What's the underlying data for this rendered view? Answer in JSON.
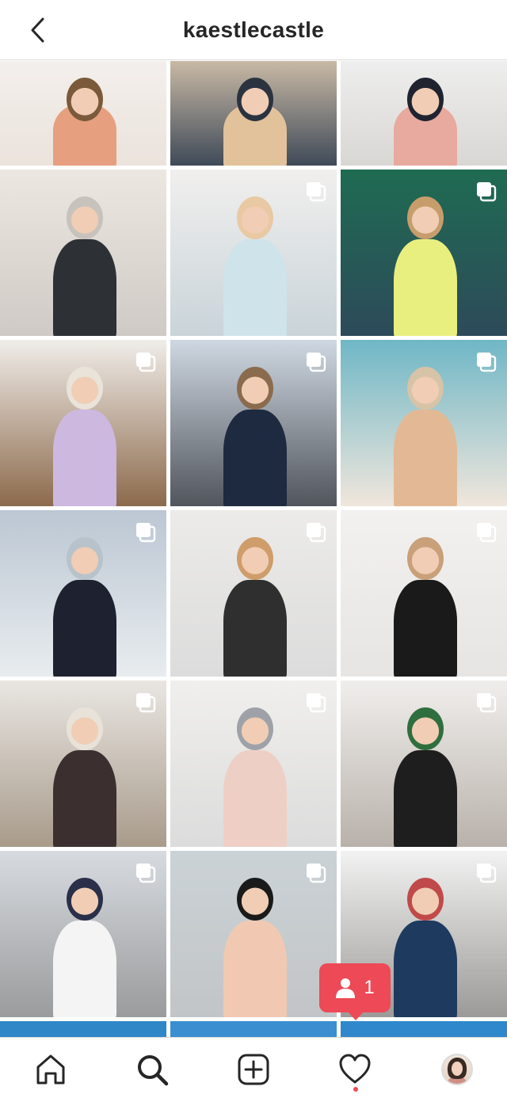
{
  "header": {
    "title": "kaestlecastle",
    "back_icon": "chevron-left-icon"
  },
  "grid": {
    "columns": 3,
    "tiles": [
      {
        "row": 1,
        "col": 1,
        "carousel": false,
        "bg": [
          "#f3efec",
          "#ebe3dc"
        ],
        "subject": "#e6a07f",
        "accent": "#7a5a3a"
      },
      {
        "row": 1,
        "col": 2,
        "carousel": false,
        "bg": [
          "#c9b9a5",
          "#3f4a58"
        ],
        "subject": "#e2c29a",
        "accent": "#2b3340"
      },
      {
        "row": 1,
        "col": 3,
        "carousel": false,
        "bg": [
          "#eeeeee",
          "#d9d7d4"
        ],
        "subject": "#e8a99e",
        "accent": "#1f2430"
      },
      {
        "row": 2,
        "col": 1,
        "carousel": false,
        "bg": [
          "#ece7e1",
          "#cfcac5"
        ],
        "subject": "#2d3035",
        "accent": "#c8c2bd"
      },
      {
        "row": 2,
        "col": 2,
        "carousel": true,
        "bg": [
          "#f1efee",
          "#c9d4d9"
        ],
        "subject": "#cfe3ea",
        "accent": "#e8c9a3"
      },
      {
        "row": 2,
        "col": 3,
        "carousel": true,
        "bg": [
          "#1f6b52",
          "#2d4a5a"
        ],
        "subject": "#e9ef7e",
        "accent": "#c79d6b"
      },
      {
        "row": 3,
        "col": 1,
        "carousel": true,
        "bg": [
          "#f0ede9",
          "#8c6a4c"
        ],
        "subject": "#cdb8e0",
        "accent": "#e9e3da"
      },
      {
        "row": 3,
        "col": 2,
        "carousel": true,
        "bg": [
          "#cfd8e2",
          "#51555c"
        ],
        "subject": "#1e2a3f",
        "accent": "#8a6b4e"
      },
      {
        "row": 3,
        "col": 3,
        "carousel": true,
        "bg": [
          "#6fb7c6",
          "#f0e6dc"
        ],
        "subject": "#e2b994",
        "accent": "#d7c3a8"
      },
      {
        "row": 4,
        "col": 1,
        "carousel": true,
        "bg": [
          "#bcc7d3",
          "#e8ecef"
        ],
        "subject": "#1e2230",
        "accent": "#b8c2cb"
      },
      {
        "row": 4,
        "col": 2,
        "carousel": true,
        "bg": [
          "#ecebe9",
          "#dcdcdc"
        ],
        "subject": "#2f2f2f",
        "accent": "#cf9d6a"
      },
      {
        "row": 4,
        "col": 3,
        "carousel": true,
        "bg": [
          "#f2f1f0",
          "#e7e5e3"
        ],
        "subject": "#1a1a1a",
        "accent": "#c9a07a"
      },
      {
        "row": 5,
        "col": 1,
        "carousel": true,
        "bg": [
          "#e9e6e2",
          "#a89b8b"
        ],
        "subject": "#3b2f2f",
        "accent": "#e8e2d8"
      },
      {
        "row": 5,
        "col": 2,
        "carousel": true,
        "bg": [
          "#f0efed",
          "#dcdcdc"
        ],
        "subject": "#eecfc6",
        "accent": "#9ea2a8"
      },
      {
        "row": 5,
        "col": 3,
        "carousel": true,
        "bg": [
          "#f0eeec",
          "#b9b2ab"
        ],
        "subject": "#1e1e1e",
        "accent": "#2f6e3e"
      },
      {
        "row": 6,
        "col": 1,
        "carousel": true,
        "bg": [
          "#d7dbe0",
          "#9a9b9c"
        ],
        "subject": "#f4f4f4",
        "accent": "#2a2f4a"
      },
      {
        "row": 6,
        "col": 2,
        "carousel": true,
        "bg": [
          "#cbd2d6",
          "#c2c5c7"
        ],
        "subject": "#f1c9b2",
        "accent": "#1a1a1a"
      },
      {
        "row": 6,
        "col": 3,
        "carousel": true,
        "bg": [
          "#f2f2f2",
          "#9c9a98"
        ],
        "subject": "#1e3a5f",
        "accent": "#c04a4a"
      },
      {
        "row": 7,
        "col": 1,
        "carousel": false,
        "bg": [
          "#2f87c8",
          "#2f87c8"
        ],
        "subject": "#2f87c8",
        "accent": "#2f87c8"
      },
      {
        "row": 7,
        "col": 2,
        "carousel": false,
        "bg": [
          "#3b8fd0",
          "#3b8fd0"
        ],
        "subject": "#3b8fd0",
        "accent": "#3b8fd0"
      },
      {
        "row": 7,
        "col": 3,
        "carousel": false,
        "bg": [
          "#2f88cc",
          "#2f88cc"
        ],
        "subject": "#2f88cc",
        "accent": "#2f88cc"
      }
    ]
  },
  "activity_badge": {
    "count": "1",
    "icon": "person-icon",
    "color": "#ed4956"
  },
  "bottom_nav": {
    "items": [
      {
        "name": "home",
        "icon": "home-icon"
      },
      {
        "name": "search",
        "icon": "search-icon",
        "active": true
      },
      {
        "name": "new-post",
        "icon": "plus-square-icon"
      },
      {
        "name": "activity",
        "icon": "heart-icon",
        "has_notification": true
      },
      {
        "name": "profile",
        "icon": "avatar-icon"
      }
    ]
  }
}
